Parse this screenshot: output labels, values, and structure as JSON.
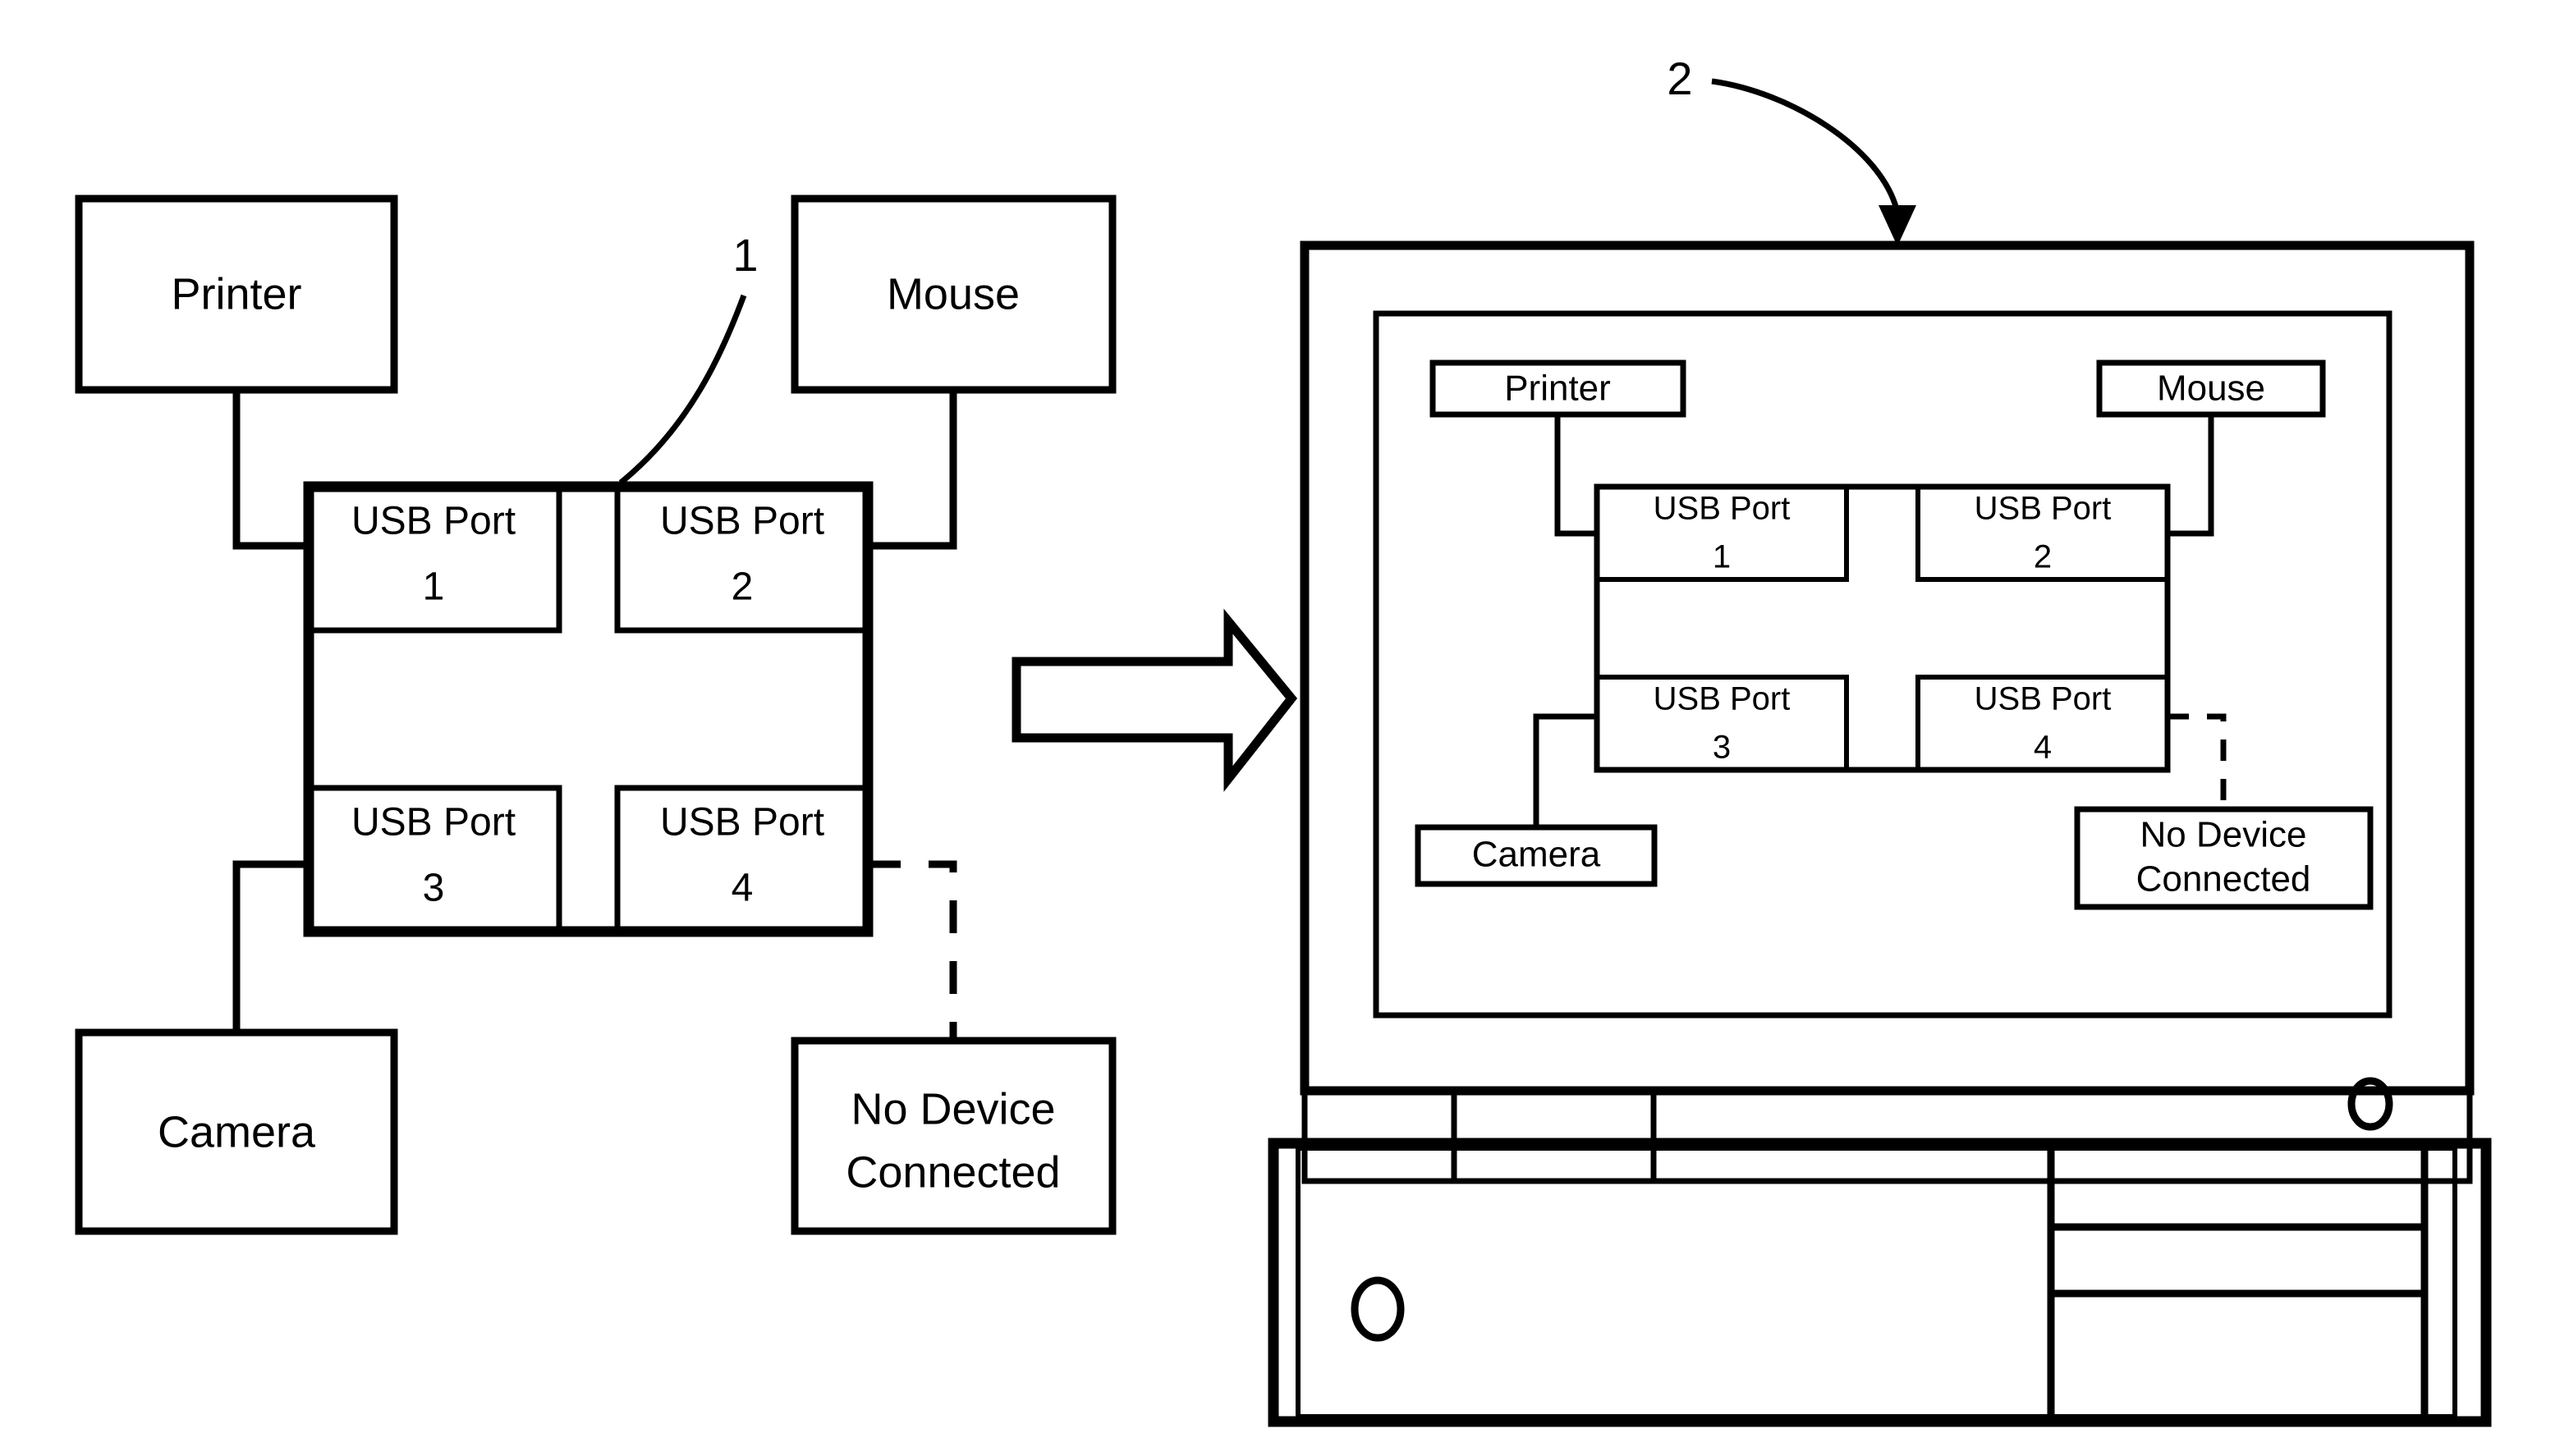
{
  "figure": {
    "title": "USB hub port-to-device mapping figure",
    "reference_numerals": {
      "hub": "1",
      "display": "2"
    }
  },
  "left_diagram": {
    "name": "standalone-usb-hub-schematic",
    "devices": {
      "printer": "Printer",
      "mouse": "Mouse",
      "camera": "Camera",
      "no_device": {
        "line1": "No Device",
        "line2": "Connected"
      }
    },
    "hub": {
      "ports": [
        {
          "line1": "USB Port",
          "line2": "1"
        },
        {
          "line1": "USB Port",
          "line2": "2"
        },
        {
          "line1": "USB Port",
          "line2": "3"
        },
        {
          "line1": "USB Port",
          "line2": "4"
        }
      ]
    },
    "callout": "1"
  },
  "transform_arrow": {
    "name": "block-arrow-right",
    "direction": "right"
  },
  "right_diagram": {
    "name": "monitor-with-onscreen-hub-map",
    "callout": "2",
    "screen_contents": {
      "devices": {
        "printer": "Printer",
        "mouse": "Mouse",
        "camera": "Camera",
        "no_device": {
          "line1": "No Device",
          "line2": "Connected"
        }
      },
      "hub": {
        "ports": [
          {
            "line1": "USB Port",
            "line2": "1"
          },
          {
            "line1": "USB Port",
            "line2": "2"
          },
          {
            "line1": "USB Port",
            "line2": "3"
          },
          {
            "line1": "USB Port",
            "line2": "4"
          }
        ]
      }
    },
    "hardware": {
      "bezel_power_button": "power-button",
      "tower_power_button": "power-button"
    }
  },
  "colors": {
    "ink": "#000000",
    "paper": "#ffffff"
  }
}
